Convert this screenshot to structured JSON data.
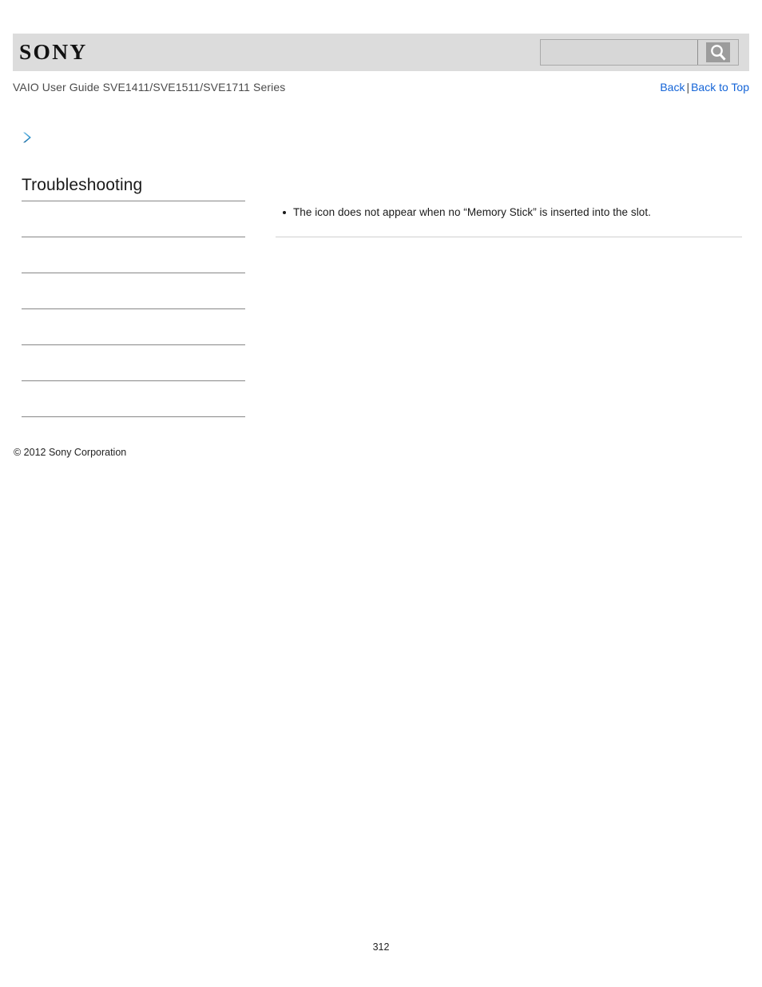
{
  "header": {
    "logo_text": "SONY",
    "logo_icon": "sony-wordmark",
    "bar_color": "#dcdcdc"
  },
  "search": {
    "value": "",
    "placeholder": "",
    "button_icon": "search-magnifier-icon",
    "button_label": "Search"
  },
  "subheader": {
    "title": "VAIO User Guide SVE1411/SVE1511/SVE1711 Series",
    "back_label": "Back",
    "separator": "|",
    "back_to_top_label": "Back to Top",
    "link_color": "#1464d7"
  },
  "marker": {
    "icon": "chevron-right-icon",
    "color_light": "#55aee0",
    "color_dark": "#1b6fa8"
  },
  "toc": {
    "title": "Troubleshooting",
    "items": [
      {
        "label": ""
      },
      {
        "label": ""
      },
      {
        "label": ""
      },
      {
        "label": ""
      },
      {
        "label": ""
      },
      {
        "label": ""
      }
    ]
  },
  "main": {
    "bullets": [
      "The icon does not appear when no “Memory Stick” is inserted into the slot."
    ]
  },
  "footer": {
    "copyright": "© 2012 Sony Corporation",
    "page_number": "312"
  }
}
